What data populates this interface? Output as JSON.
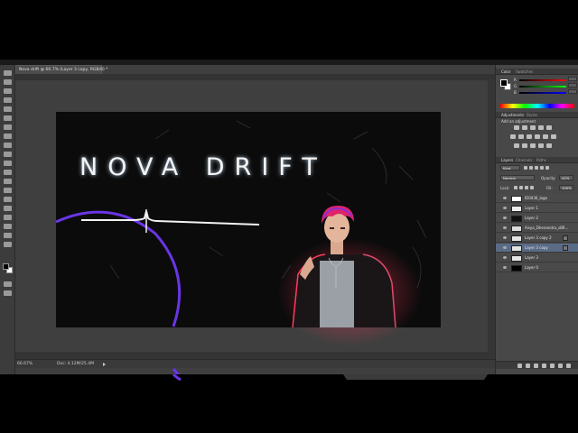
{
  "document": {
    "tab_title": "Nova drift @ 66.7% (Layer 3 copy, RGB/8) *"
  },
  "canvas": {
    "title_text": "NOVA DRIFT"
  },
  "status": {
    "zoom": "66.67%",
    "doc_size": "Doc: 4.12M/25.4M"
  },
  "panels": {
    "color_tabs": [
      "Color",
      "Swatches"
    ],
    "color_channels": [
      "R",
      "G",
      "B"
    ],
    "adjustments_tabs": [
      "Adjustments",
      "Styles"
    ],
    "adjustments_hint": "Add an adjustment",
    "layers_tabs": [
      "Layers",
      "Channels",
      "Paths"
    ],
    "kind_label": "Kind",
    "blend_mode": "Normal",
    "opacity_label": "Opacity:",
    "opacity_value": "42%",
    "lock_label": "Lock:",
    "fill_label": "Fill:",
    "fill_value": "100%",
    "layers": [
      {
        "name": "ID0036_logo",
        "selected": false
      },
      {
        "name": "Layer 1",
        "selected": false
      },
      {
        "name": "Layer 2",
        "selected": false
      },
      {
        "name": "Aisya_Dhenandra_sBR...",
        "selected": false
      },
      {
        "name": "Layer 3 copy 2",
        "selected": false
      },
      {
        "name": "Layer 3 copy",
        "selected": true
      },
      {
        "name": "Layer 3",
        "selected": false
      },
      {
        "name": "Layer 0",
        "selected": false
      }
    ]
  },
  "colors": {
    "accent_purple": "#6a35e6",
    "selection_blue": "#5a6b86"
  }
}
